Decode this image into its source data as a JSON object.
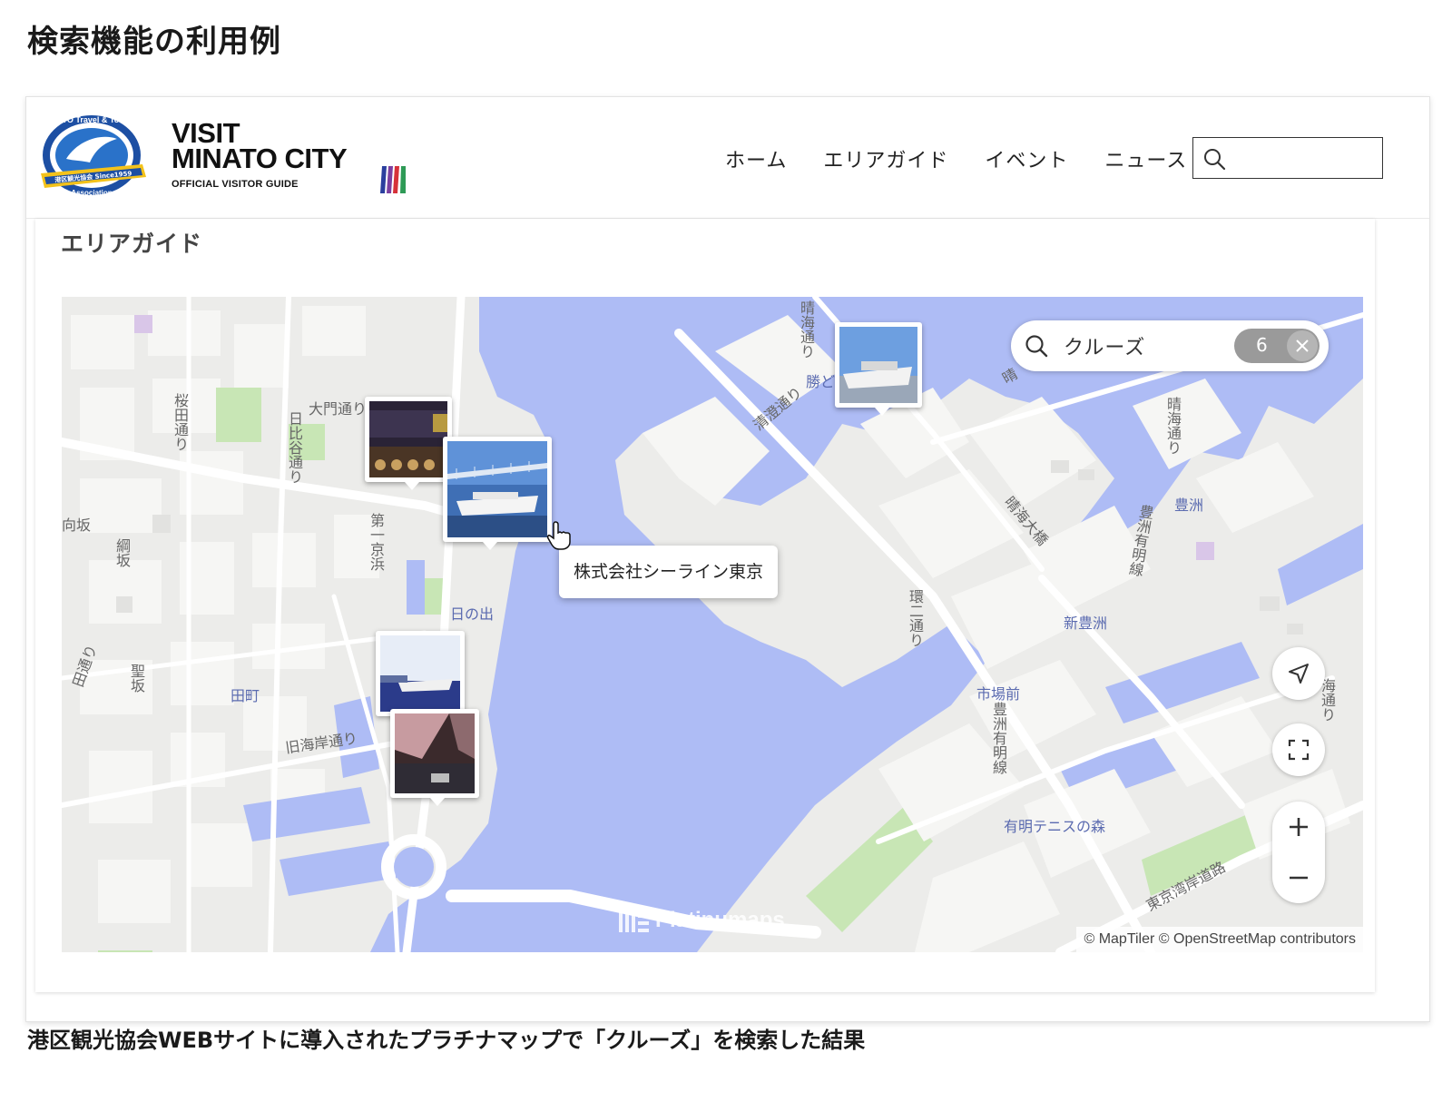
{
  "page": {
    "heading": "検索機能の利用例",
    "caption": "港区観光協会WEBサイトに導入されたプラチナマップで「クルーズ」を検索した結果"
  },
  "header": {
    "brand_line1": "VISIT",
    "brand_line2": "MINATO CITY",
    "brand_sub": "OFFICIAL VISITOR GUIDE",
    "seal_top_text": "MINATO Travel & Tourism",
    "seal_bottom_text": "Association",
    "seal_band_text": "港区観光協会 Since1959",
    "nav": [
      "ホーム",
      "エリアガイド",
      "イベント",
      "ニュース"
    ],
    "search_value": "",
    "search_placeholder": ""
  },
  "section": {
    "title": "エリアガイド"
  },
  "map": {
    "search_query": "クルーズ",
    "result_count": "6",
    "tooltip": "株式会社シーライン東京",
    "attribution": "© MapTiler © OpenStreetMap contributors",
    "watermark": "Platinumaps",
    "labels": {
      "daimon": "大門通り",
      "sakurada": "桜田通り",
      "hibiya": "日比谷通り",
      "daiichi_keihin": "第一京浜",
      "hinode": "日の出",
      "tamachi": "田町",
      "kyu_kaigan": "旧海岸通り",
      "harumi_dori": "晴海通り",
      "kiyosumi": "清澄通り",
      "kachidoki": "勝ど",
      "harumi_ohashi": "晴海大橋",
      "toyosu": "豊洲",
      "shin_toyosu": "新豊洲",
      "shijomae": "市場前",
      "ariake_tennis": "有明テニスの森",
      "toyosu_ariake": "豊洲有明線",
      "tokyo_wangan": "東京湾岸道路",
      "kanpachi": "環二通り",
      "muko": "向坂",
      "tsuna": "綱坂",
      "hijiri": "聖坂",
      "mita": "田通り",
      "harumi_right": "晴海通り",
      "kaigan_right": "海通り",
      "harumi_top": "晴",
      "toyosu_tsuri": "豊洲有明線"
    }
  },
  "colors": {
    "water": "#aebcf5",
    "land": "#ececea",
    "park": "#c8e6b5",
    "block": "#f6f6f4",
    "road": "#ffffff",
    "pill": "#9a9a9a"
  },
  "icons": {
    "site_search": "search-icon",
    "map_search": "search-icon",
    "clear": "close-icon",
    "locate": "navigation-arrow-icon",
    "fullscreen": "fullscreen-icon",
    "zoom_in": "plus-icon",
    "zoom_out": "minus-icon",
    "cursor": "hand-pointer-icon"
  }
}
